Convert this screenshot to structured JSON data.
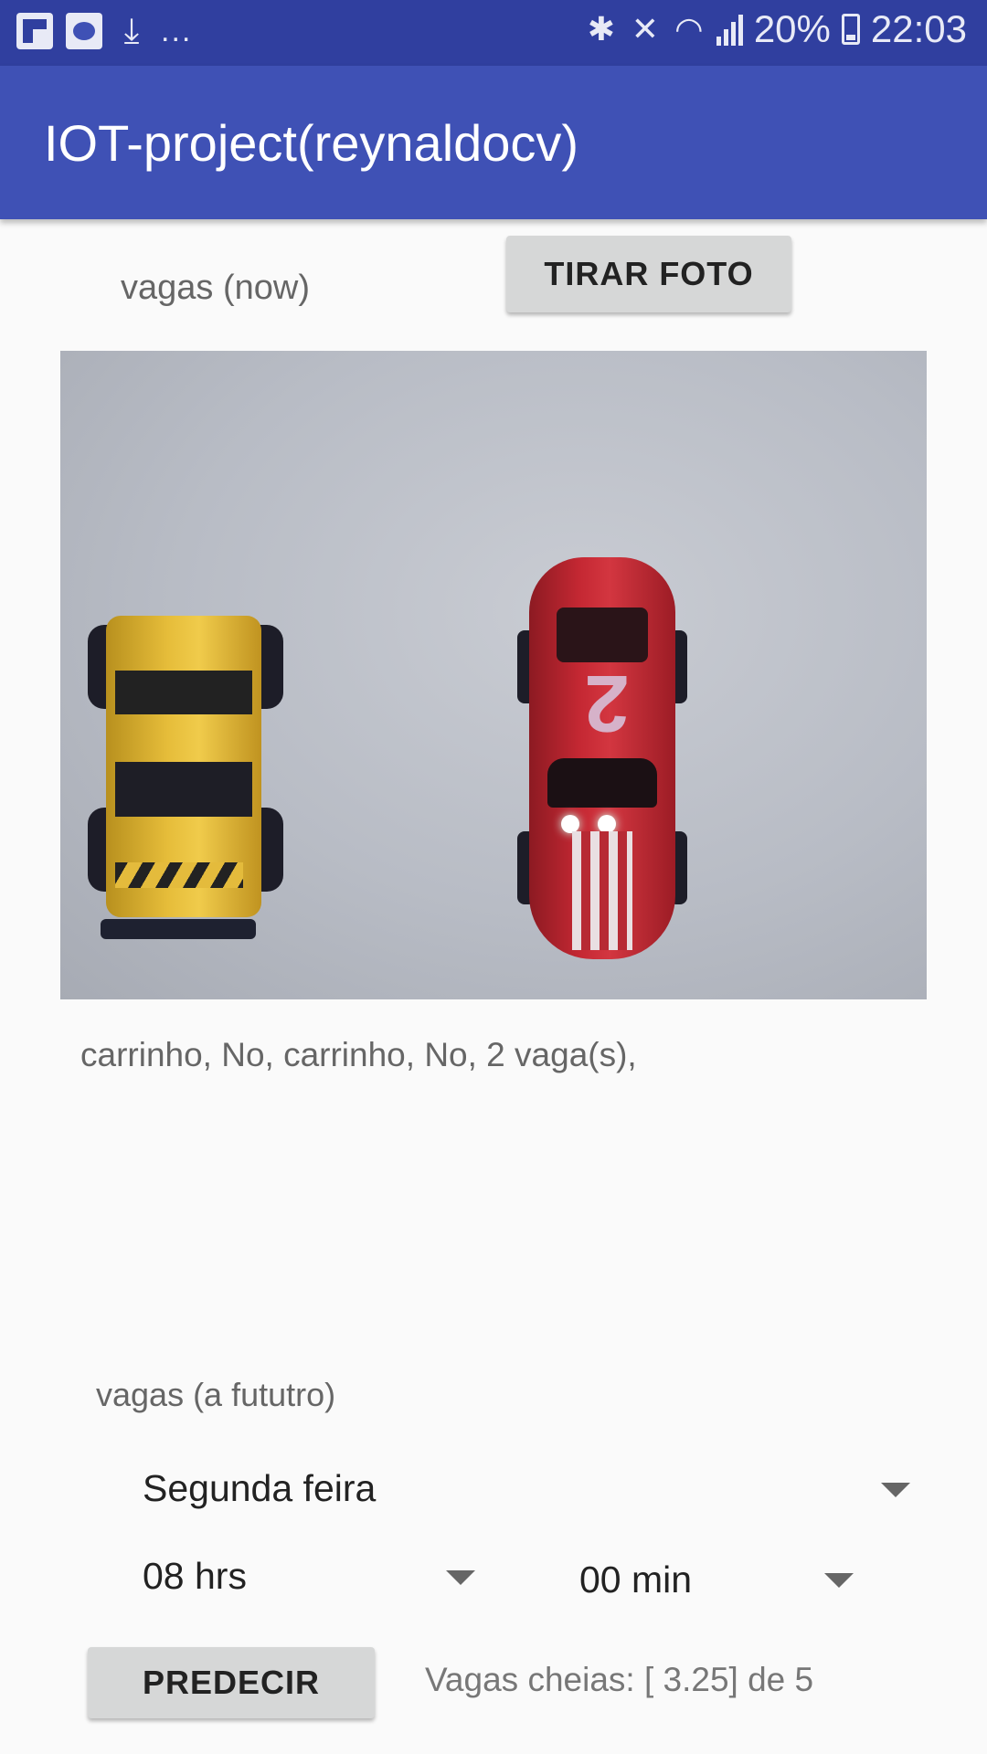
{
  "status_bar": {
    "icons_left": [
      "flipboard-icon",
      "cloud-app-icon",
      "download-icon",
      "more-notifications-icon"
    ],
    "icons_right": [
      "bluetooth-icon",
      "mute-icon",
      "wifi-icon",
      "signal-icon",
      "battery-icon"
    ],
    "more": "...",
    "battery": "20%",
    "time": "22:03"
  },
  "app_bar": {
    "title": "IOT-project(reynaldocv)"
  },
  "now_section": {
    "label": "vagas (now)",
    "take_photo_button": "TIRAR FOTO",
    "photo": {
      "car_number": "2"
    },
    "result": "carrinho, No, carrinho, No, 2 vaga(s),"
  },
  "future_section": {
    "label": "vagas (a fututro)",
    "day_select": {
      "selected": "Segunda feira"
    },
    "hour_select": {
      "selected": "08 hrs"
    },
    "minute_select": {
      "selected": "00 min"
    },
    "predict_button": "PREDECIR",
    "prediction": "Vagas cheias: [ 3.25] de 5"
  },
  "colors": {
    "status_bar": "#303f9f",
    "app_bar": "#3f51b5",
    "background": "#fafafa",
    "button": "#d6d7d7"
  }
}
